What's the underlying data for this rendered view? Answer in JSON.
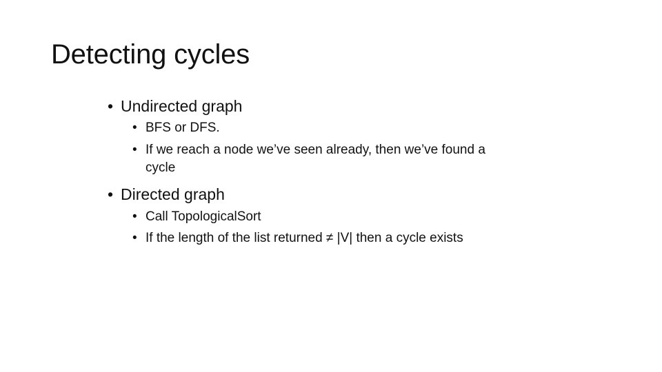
{
  "slide": {
    "title": "Detecting cycles",
    "bullet_glyph": "•",
    "sections": [
      {
        "heading": "Undirected graph",
        "items": [
          "BFS or DFS.",
          "If we reach a node we’ve seen already, then we’ve found a",
          "cycle"
        ]
      },
      {
        "heading": "Directed graph",
        "items": [
          "Call TopologicalSort",
          "If the length of the list returned ≠ |V| then a cycle exists"
        ]
      }
    ]
  }
}
